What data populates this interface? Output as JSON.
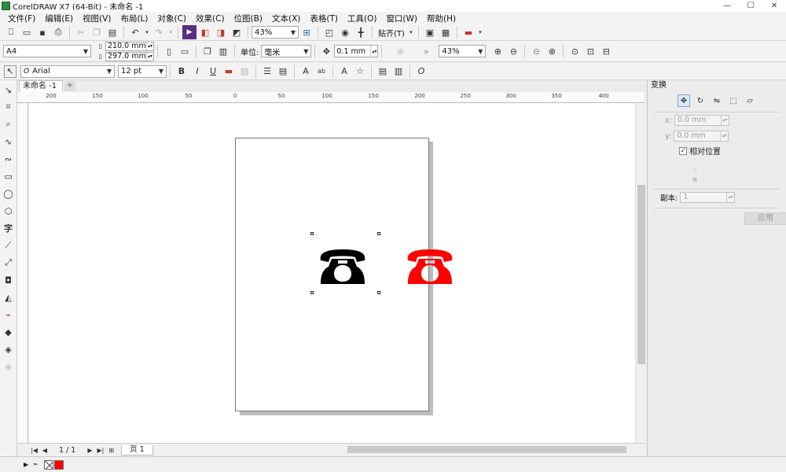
{
  "window": {
    "title": "CorelDRAW X7 (64-Bit) - 未命名 -1",
    "controls": [
      "—",
      "☐",
      "✕"
    ]
  },
  "menubar": {
    "items": [
      "文件(F)",
      "编辑(E)",
      "视图(V)",
      "布局(L)",
      "对象(C)",
      "效果(C)",
      "位图(B)",
      "文本(X)",
      "表格(T)",
      "工具(O)",
      "窗口(W)",
      "帮助(H)"
    ]
  },
  "standard_toolbar": {
    "zoom_value": "43%",
    "snap_label": "贴齐(T)"
  },
  "property_bar": {
    "paper_size": "A4",
    "width_value": "210.0 mm",
    "height_value": "297.0 mm",
    "unit_label": "单位:",
    "unit_value": "毫米",
    "nudge_value": "0.1 mm",
    "zoom_value": "43%"
  },
  "text_toolbar": {
    "font_name": "Arial",
    "font_size": "12 pt"
  },
  "document": {
    "tab_label": "未命名 -1",
    "page_count": "1 / 1",
    "page_tab": "页 1"
  },
  "ruler": {
    "labels": [
      "200",
      "150",
      "100",
      "50",
      "0",
      "50",
      "100",
      "150",
      "200",
      "250",
      "300",
      "350",
      "400"
    ]
  },
  "canvas_objects": {
    "phone_black_color": "#000000",
    "phone_red_color": "#ff0000"
  },
  "palette": {
    "swatches": [
      "#ff0000"
    ]
  },
  "transform_docker": {
    "title": "变换",
    "x_label": "x:",
    "x_value": "0.0 mm",
    "y_label": "y:",
    "y_value": "0.0 mm",
    "relative_position_label": "相对位置",
    "copies_label": "副本:",
    "copies_value": "1",
    "apply_label": "应用"
  }
}
